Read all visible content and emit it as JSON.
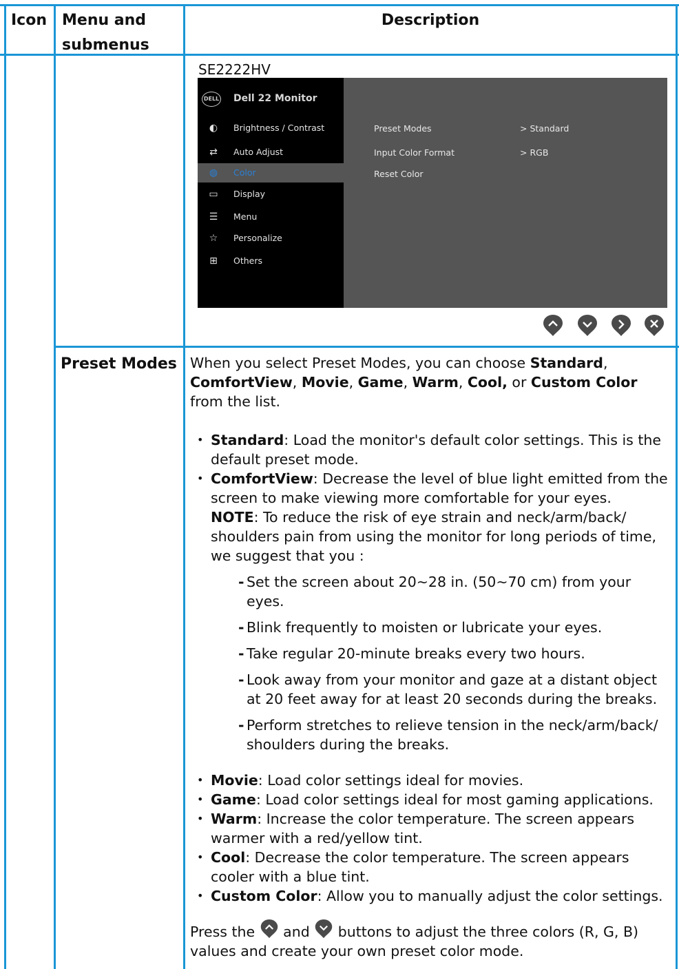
{
  "table": {
    "headers": {
      "icon": "Icon",
      "menu": "Menu and submenus",
      "description": "Description"
    }
  },
  "model_label": "SE2222HV",
  "osd": {
    "logo_text": "DELL",
    "title": "Dell 22 Monitor",
    "menu_items": [
      {
        "label": "Brightness / Contrast",
        "icon": "brightness-icon"
      },
      {
        "label": "Auto Adjust",
        "icon": "auto-adjust-icon"
      },
      {
        "label": "Color",
        "icon": "color-icon",
        "selected": true
      },
      {
        "label": "Display",
        "icon": "display-icon"
      },
      {
        "label": "Menu",
        "icon": "menu-icon"
      },
      {
        "label": "Personalize",
        "icon": "star-icon"
      },
      {
        "label": "Others",
        "icon": "others-icon"
      }
    ],
    "submenu": [
      {
        "label": "Preset Modes",
        "value": ">  Standard"
      },
      {
        "label": "Input Color Format",
        "value": ">  RGB"
      },
      {
        "label": "Reset Color",
        "value": ""
      }
    ],
    "colors": {
      "panel": "#555555",
      "sidebar": "#000000",
      "selected": "#2b80d6"
    }
  },
  "nav_buttons": [
    "up-button",
    "down-button",
    "right-button",
    "exit-button"
  ],
  "preset_modes": {
    "menu_label": "Preset Modes",
    "intro": {
      "p1": "When you select Preset Modes, you can choose ",
      "opt_standard": "Standard",
      "sep1": ",",
      "opt_comfortview": "ComfortView",
      "sep2": ", ",
      "opt_movie": "Movie",
      "sep3": ", ",
      "opt_game": "Game",
      "sep4": ", ",
      "opt_warm": "Warm",
      "sep5": ", ",
      "opt_cool": "Cool,",
      "sep6": " or ",
      "opt_custom": "Custom Color",
      "p2": " from the list."
    },
    "bullets": {
      "standard_term": "Standard",
      "standard_text": ": Load the monitor's default color settings. This is the default preset mode.",
      "comfort_term": "ComfortView",
      "comfort_text": ": Decrease the level of blue light emitted from the screen to make viewing more comfortable for your eyes.",
      "note_term": "NOTE",
      "note_text": ": To reduce the risk of eye strain and neck/arm/back/ shoulders pain from using the monitor for long periods of time, we suggest that you :",
      "movie_term": "Movie",
      "movie_text": ": Load color settings ideal for movies.",
      "game_term": "Game",
      "game_text": ": Load color settings ideal for most gaming applications.",
      "warm_term": "Warm",
      "warm_text": ": Increase the color temperature. The screen appears warmer with a red/yellow tint.",
      "cool_term": "Cool",
      "cool_text": ": Decrease the color temperature. The screen appears cooler with a blue tint.",
      "custom_term": "Custom Color",
      "custom_text": ": Allow you to manually adjust the color settings."
    },
    "tips": [
      "Set the screen about 20~28 in. (50~70 cm) from your eyes.",
      "Blink frequently to moisten or lubricate your eyes.",
      "Take regular 20-minute breaks every two hours.",
      "Look away from your monitor and gaze at a distant object at 20 feet away for at least 20 seconds during the breaks.",
      "Perform stretches to relieve tension in the neck/arm/back/ shoulders during the breaks."
    ],
    "press": {
      "p1": "Press the ",
      "p2": " and ",
      "p3": " buttons to adjust the three colors (R, G, B) values and create your own preset color mode."
    }
  },
  "colors": {
    "border": "#1a96d6",
    "button": "#4a4a4a"
  }
}
